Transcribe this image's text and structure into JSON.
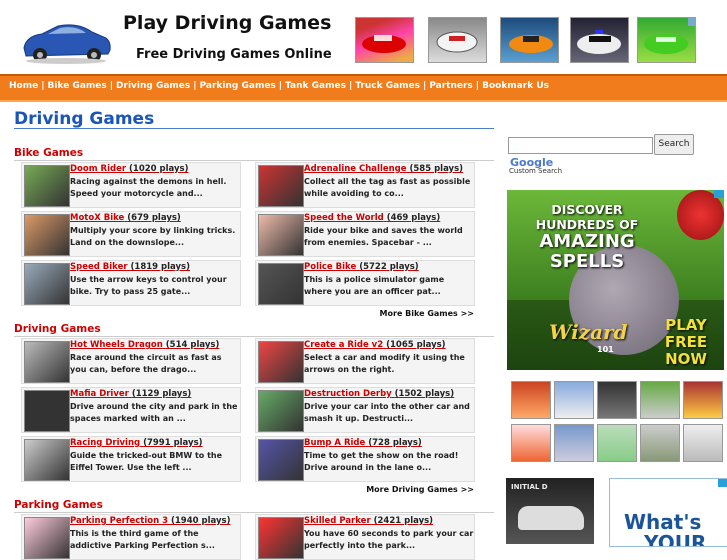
{
  "header": {
    "title": "Play Driving Games",
    "subtitle": "Free Driving Games Online"
  },
  "nav": [
    "Home",
    "Bike Games",
    "Driving Games",
    "Parking Games",
    "Tank Games",
    "Truck Games",
    "Partners",
    "Bookmark Us"
  ],
  "main": {
    "title": "Driving Games",
    "sections": [
      {
        "title": "Bike Games",
        "more": "More Bike Games >>",
        "games": [
          {
            "name": "Doom Rider",
            "plays": "(1020 plays)",
            "desc": "Racing against the demons in hell. Speed your motorcycle and..."
          },
          {
            "name": "Adrenaline Challenge",
            "plays": "(585 plays)",
            "desc": "Collect all the tag as fast as possible while avoiding to co..."
          },
          {
            "name": "MotoX Bike",
            "plays": "(679 plays)",
            "desc": "Multiply your score by linking tricks. Land on the downslope..."
          },
          {
            "name": "Speed the World",
            "plays": "(469 plays)",
            "desc": "Ride your bike and saves the world from enemies. Spacebar - ..."
          },
          {
            "name": "Speed Biker",
            "plays": "(1819 plays)",
            "desc": "Use the arrow keys to control your bike. Try to pass 25 gate..."
          },
          {
            "name": "Police Bike",
            "plays": "(5722 plays)",
            "desc": "This is a police simulator game where you are an officer pat..."
          }
        ]
      },
      {
        "title": "Driving Games",
        "more": "More Driving Games >>",
        "games": [
          {
            "name": "Hot Wheels Dragon",
            "plays": "(514 plays)",
            "desc": "Race around the circuit as fast as you can, before the drago..."
          },
          {
            "name": "Create a Ride v2",
            "plays": "(1065 plays)",
            "desc": "Select a car and modify it using the arrows on the right."
          },
          {
            "name": "Mafia Driver",
            "plays": "(1129 plays)",
            "desc": "Drive around the city and park in the spaces marked with an ..."
          },
          {
            "name": "Destruction Derby",
            "plays": "(1502 plays)",
            "desc": "Drive your car into the other car and smash it up. Destructi..."
          },
          {
            "name": "Racing Driving",
            "plays": "(7991 plays)",
            "desc": "Guide the tricked-out BMW to the Eiffel Tower. Use the left ..."
          },
          {
            "name": "Bump A Ride",
            "plays": "(728 plays)",
            "desc": "Time to get the show on the road! Drive around in the lane o..."
          }
        ]
      },
      {
        "title": "Parking Games",
        "games": [
          {
            "name": "Parking Perfection 3",
            "plays": "(1940 plays)",
            "desc": "This is the third game of the addictive Parking Perfection s..."
          },
          {
            "name": "Skilled Parker",
            "plays": "(2421 plays)",
            "desc": "You have 60 seconds to park your car perfectly into the park..."
          }
        ]
      }
    ]
  },
  "sidebar": {
    "search_button": "Search",
    "google": "Google",
    "custom_search": "Custom Search",
    "ad_wizard": {
      "line1": "DISCOVER",
      "line2": "HUNDREDS OF",
      "line3": "AMAZING",
      "line4": "SPELLS",
      "logo": "Wizard",
      "logo_sub": "101",
      "cta": "PLAY FREE NOW"
    },
    "ad_drift_label": "INITIAL D",
    "ad_whats": {
      "line1": "What's",
      "line2": "YOUR"
    }
  },
  "colors": {
    "accent": "#f07c1c",
    "link": "#cc0000",
    "heading": "#1a56b8"
  }
}
